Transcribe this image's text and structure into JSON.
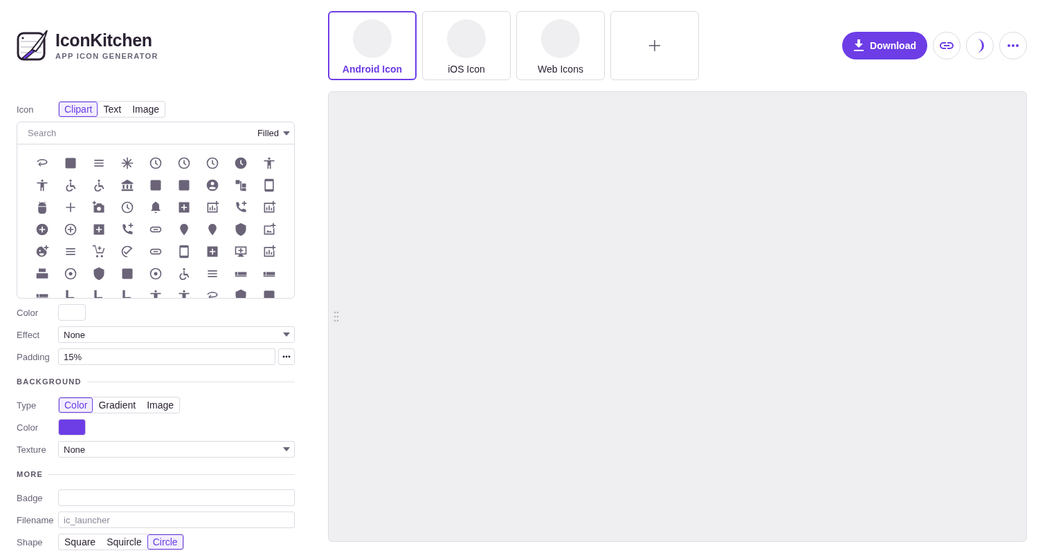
{
  "app": {
    "title": "IconKitchen",
    "subtitle": "APP ICON GENERATOR"
  },
  "targets": [
    {
      "label": "Android Icon",
      "selected": true
    },
    {
      "label": "iOS Icon",
      "selected": false
    },
    {
      "label": "Web Icons",
      "selected": false
    }
  ],
  "header": {
    "download": "Download"
  },
  "icon": {
    "label": "Icon",
    "modes": [
      {
        "label": "Clipart",
        "selected": true
      },
      {
        "label": "Text",
        "selected": false
      },
      {
        "label": "Image",
        "selected": false
      }
    ],
    "search": {
      "placeholder": "Search"
    },
    "style": "Filled",
    "color": {
      "label": "Color",
      "color": "#ffffff"
    },
    "effect": {
      "label": "Effect",
      "value": "None"
    },
    "padding": {
      "label": "Padding",
      "value": "15%"
    }
  },
  "background": {
    "heading": "BACKGROUND",
    "type": {
      "label": "Type",
      "options": [
        {
          "label": "Color",
          "selected": true
        },
        {
          "label": "Gradient",
          "selected": false
        },
        {
          "label": "Image",
          "selected": false
        }
      ]
    },
    "color": {
      "label": "Color",
      "color": "#6d3de6"
    },
    "texture": {
      "label": "Texture",
      "value": "None"
    }
  },
  "more": {
    "heading": "MORE",
    "badge": {
      "label": "Badge"
    },
    "filename": {
      "label": "Filename",
      "placeholder": "ic_launcher"
    },
    "shape": {
      "label": "Shape",
      "options": [
        {
          "label": "Square",
          "selected": false
        },
        {
          "label": "Squircle",
          "selected": false
        },
        {
          "label": "Circle",
          "selected": true
        }
      ]
    }
  }
}
